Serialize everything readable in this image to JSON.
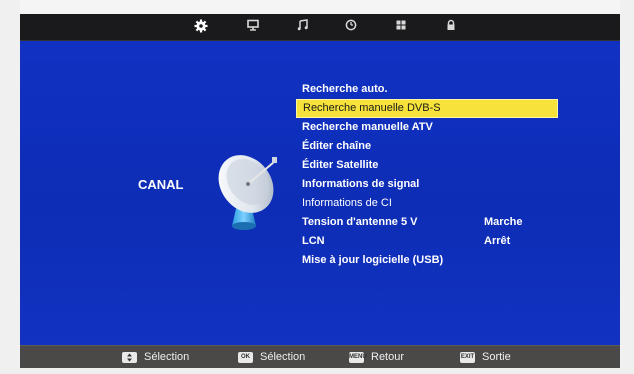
{
  "top_menu": {
    "icons": [
      {
        "name": "settings",
        "active": true
      },
      {
        "name": "monitor",
        "active": false
      },
      {
        "name": "music",
        "active": false
      },
      {
        "name": "clock",
        "active": false
      },
      {
        "name": "grid",
        "active": false
      },
      {
        "name": "lock",
        "active": false
      }
    ]
  },
  "section": {
    "title": "CANAL"
  },
  "menu": {
    "items": [
      {
        "label": "Recherche auto.",
        "value": "",
        "selected": false
      },
      {
        "label": "Recherche manuelle DVB-S",
        "value": "",
        "selected": true
      },
      {
        "label": "Recherche manuelle ATV",
        "value": "",
        "selected": false
      },
      {
        "label": "Éditer chaîne",
        "value": "",
        "selected": false
      },
      {
        "label": "Éditer Satellite",
        "value": "",
        "selected": false
      },
      {
        "label": "Informations de signal",
        "value": "",
        "selected": false
      },
      {
        "label": "Informations de CI",
        "value": "",
        "selected": false
      },
      {
        "label": "Tension d'antenne 5 V",
        "value": "Marche",
        "selected": false
      },
      {
        "label": "LCN",
        "value": "Arrêt",
        "selected": false
      },
      {
        "label": "Mise à jour logicielle (USB)",
        "value": "",
        "selected": false
      }
    ]
  },
  "bottom_bar": {
    "hints": [
      {
        "key": "arrows",
        "label": "Sélection"
      },
      {
        "key": "OK",
        "label": "Sélection"
      },
      {
        "key": "MENU",
        "label": "Retour"
      },
      {
        "key": "EXIT",
        "label": "Sortie"
      }
    ]
  },
  "colors": {
    "screen_bg": "#1132c4",
    "highlight": "#f6e23a",
    "topbar": "#1a1a1c",
    "bottombar": "#4a4948"
  }
}
